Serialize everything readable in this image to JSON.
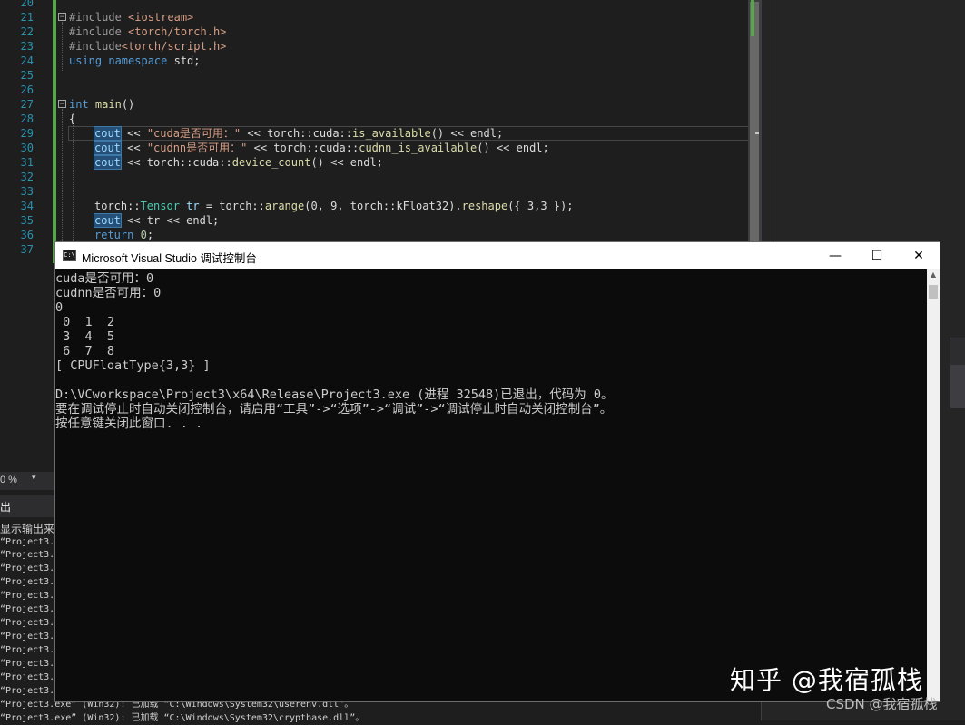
{
  "editor": {
    "line_numbers": [
      "20",
      "21",
      "22",
      "23",
      "24",
      "25",
      "26",
      "27",
      "28",
      "29",
      "30",
      "31",
      "32",
      "33",
      "34",
      "35",
      "36",
      "37"
    ],
    "fold_symbol": "−",
    "code": {
      "l21_pp": "#include",
      "l21_hdr": " <iostream>",
      "l22_pp": "#include",
      "l22_hdr": " <torch/torch.h>",
      "l23_pp": "#include",
      "l23_hdr": "<torch/script.h>",
      "l24_kw1": "using",
      "l24_kw2": " namespace",
      "l24_rest": " std;",
      "l27_kw": "int",
      "l27_fn": " main",
      "l27_rest": "()",
      "l28": "{",
      "l29_cout": "cout",
      "l29_op": " << ",
      "l29_str": "\"cuda是否可用：\"",
      "l29_op2": " << torch::cuda::",
      "l29_fn": "is_available",
      "l29_rest": "() << endl;",
      "l30_cout": "cout",
      "l30_op": " << ",
      "l30_str": "\"cudnn是否可用：\"",
      "l30_op2": " << torch::cuda::",
      "l30_fn": "cudnn_is_available",
      "l30_rest": "() << endl;",
      "l31_cout": "cout",
      "l31_op": " << torch::cuda::",
      "l31_fn": "device_count",
      "l31_rest": "() << endl;",
      "l34_ns": "torch::",
      "l34_ty": "Tensor",
      "l34_var": " tr",
      "l34_eq": " = torch::",
      "l34_fn": "arange",
      "l34_args": "(0, 9, torch::kFloat32).",
      "l34_fn2": "reshape",
      "l34_rest": "({ 3,3 });",
      "l35_cout": "cout",
      "l35_rest": " << tr << endl;",
      "l36_kw": "return",
      "l36_num": " 0",
      "l36_rest": ";"
    },
    "zoom": "0 %",
    "zoom_arrow": "▾",
    "output_title": "出",
    "output_source": "显示输出来源",
    "output_lines": [
      "“Project3.",
      "“Project3.",
      "“Project3.",
      "“Project3.",
      "“Project3.",
      "“Project3.",
      "“Project3.",
      "“Project3.",
      "“Project3.",
      "“Project3.",
      "“Project3.",
      "“Project3.",
      "“Project3.",
      "“Project3.exe” (Win32): 已加载 “C:\\Windows\\System32\\userenv.dll”。",
      "“Project3.exe” (Win32): 已加载 “C:\\Windows\\System32\\cryptbase.dll”。"
    ]
  },
  "console": {
    "title": "Microsoft Visual Studio 调试控制台",
    "icon_text": "C:\\",
    "minimize": "—",
    "maximize": "☐",
    "close": "✕",
    "lines": [
      "cuda是否可用：0",
      "cudnn是否可用：0",
      "0",
      " 0  1  2",
      " 3  4  5",
      " 6  7  8",
      "[ CPUFloatType{3,3} ]",
      "",
      "D:\\VCworkspace\\Project3\\x64\\Release\\Project3.exe (进程 32548)已退出，代码为 0。",
      "要在调试停止时自动关闭控制台，请启用“工具”->“选项”->“调试”->“调试停止时自动关闭控制台”。",
      "按任意键关闭此窗口. . ."
    ]
  },
  "watermark": {
    "zhihu": "知乎 @我宿孤栈",
    "csdn": "CSDN @我宿孤栈"
  }
}
